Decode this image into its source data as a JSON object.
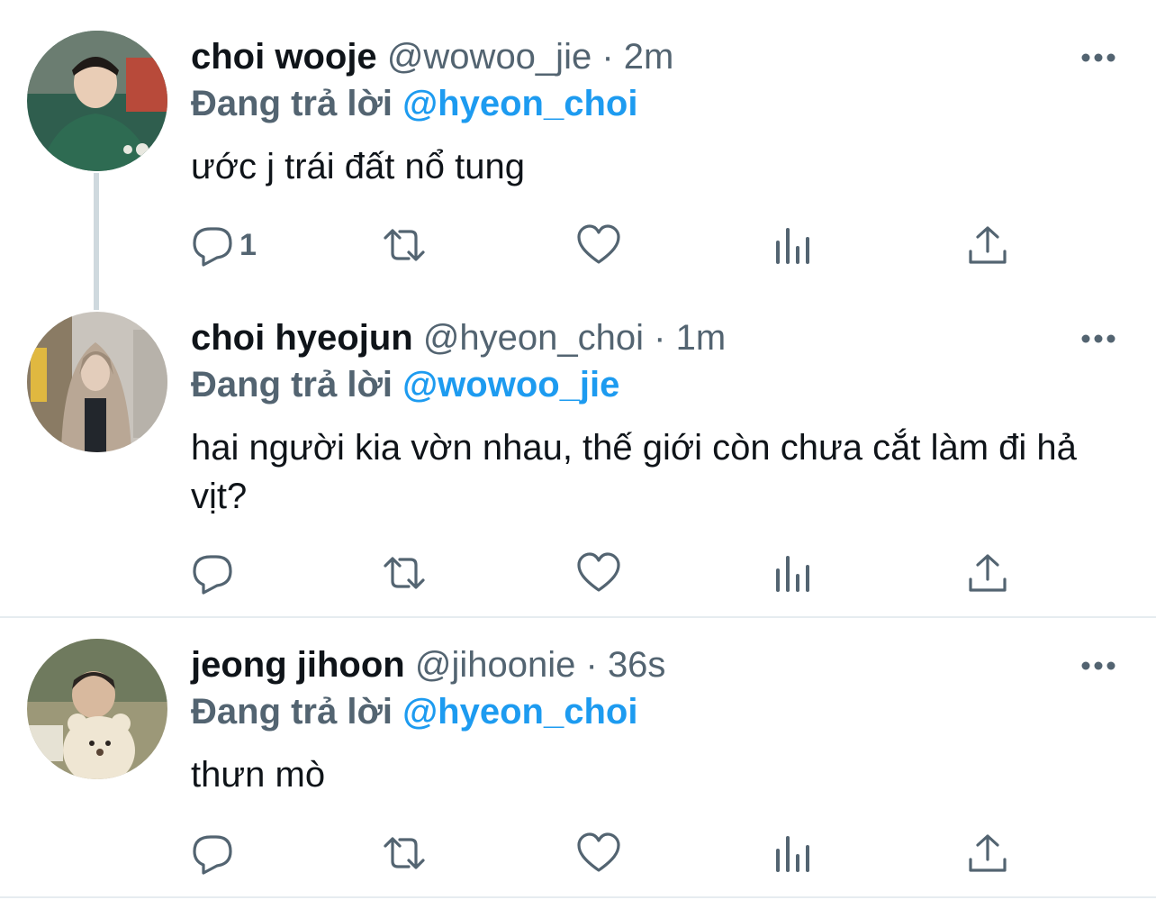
{
  "tweets": [
    {
      "name": "choi wooje",
      "handle": "@wowoo_jie",
      "separator": "·",
      "time": "2m",
      "reply_prefix": "Đang trả lời",
      "reply_target": "@hyeon_choi",
      "text": "ước j trái đất nổ tung",
      "reply_count": "1",
      "avatar_icon": "avatar-photo"
    },
    {
      "name": "choi hyeojun",
      "handle": "@hyeon_choi",
      "separator": "·",
      "time": "1m",
      "reply_prefix": "Đang trả lời",
      "reply_target": "@wowoo_jie",
      "text": "hai người kia vờn nhau, thế giới còn chưa cắt làm đi hả vịt?",
      "reply_count": "",
      "avatar_icon": "avatar-photo"
    },
    {
      "name": "jeong jihoon",
      "handle": "@jihoonie",
      "separator": "·",
      "time": "36s",
      "reply_prefix": "Đang trả lời",
      "reply_target": "@hyeon_choi",
      "text": "thưn mò",
      "reply_count": "",
      "avatar_icon": "avatar-photo"
    }
  ],
  "icons": {
    "reply": "reply-icon",
    "retweet": "retweet-icon",
    "like": "heart-icon",
    "analytics": "analytics-icon",
    "share": "share-icon",
    "more": "more-icon"
  },
  "colors": {
    "text": "#0f1419",
    "secondary": "#536471",
    "accent": "#1d9bf0",
    "divider": "#e6ecf0",
    "thread_line": "#cfd9de"
  }
}
